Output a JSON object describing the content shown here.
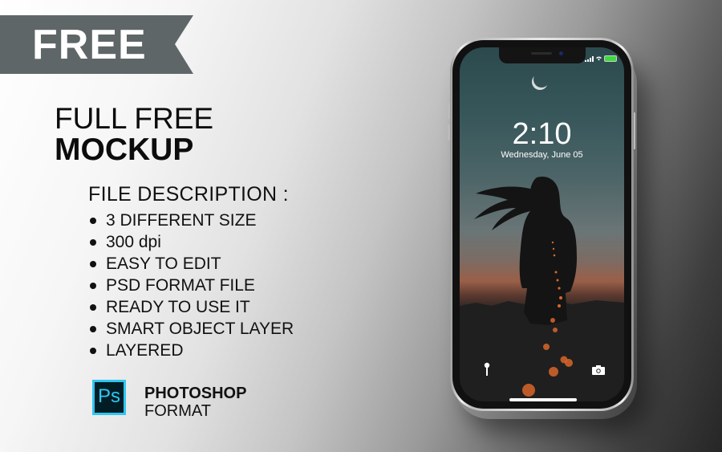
{
  "banner": {
    "ribbon_label": "FREE",
    "ribbon_color": "#5f6668"
  },
  "headline": {
    "line1": "FULL FREE",
    "line2": "MOCKUP"
  },
  "description": {
    "heading": "FILE DESCRIPTION :",
    "items": [
      "3 DIFFERENT SIZE",
      "300 dpi",
      "EASY TO EDIT",
      "PSD FORMAT FILE",
      "READY TO USE IT",
      "SMART OBJECT LAYER",
      "LAYERED"
    ]
  },
  "format": {
    "logo_text": "Ps",
    "logo_color": "#31c5f0",
    "logo_bg": "#001d26",
    "title": "PHOTOSHOP",
    "subtitle": "FORMAT"
  },
  "phone": {
    "lock_screen": {
      "time": "2:10",
      "date": "Wednesday, June 05",
      "battery_color": "#3ddc3d",
      "icons": [
        "moon-icon",
        "signal-icon",
        "wifi-icon",
        "battery-icon",
        "flashlight-icon",
        "camera-icon"
      ]
    }
  }
}
